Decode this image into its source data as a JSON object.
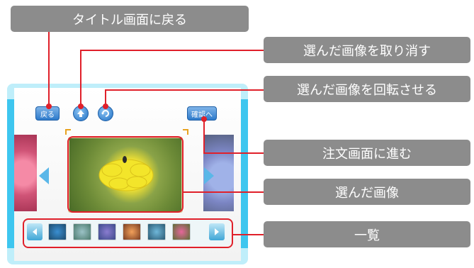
{
  "callouts": {
    "back_to_title": "タイトル画面に戻る",
    "undo_selection": "選んだ画像を取り消す",
    "rotate_image": "選んだ画像を回転させる",
    "proceed_to_order": "注文画面に進む",
    "selected_image": "選んだ画像",
    "list": "一覧"
  },
  "ui": {
    "back_button": "戻る",
    "confirm_button": "確認へ"
  },
  "icons": {
    "undo": "up-arrow-icon",
    "rotate": "rotate-icon",
    "prev": "left-arrow-icon",
    "next": "right-arrow-icon"
  },
  "colors": {
    "accent_line": "#e0202a",
    "callout_bg": "#8c8c8c",
    "button_blue": "#2e7acb",
    "frame_cyan": "#3ec6ef"
  }
}
